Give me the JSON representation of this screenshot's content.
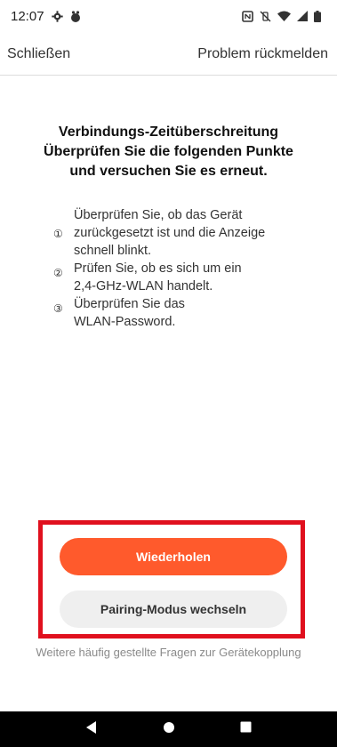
{
  "status_bar": {
    "time": "12:07",
    "icons_left": [
      "settings-icon",
      "notification-icon"
    ],
    "icons_right": [
      "nfc-icon",
      "no-vibrate-icon",
      "wifi-icon",
      "signal-icon",
      "battery-icon"
    ]
  },
  "nav": {
    "close_label": "Schließen",
    "report_label": "Problem rückmelden"
  },
  "title": {
    "line1": "Verbindungs-Zeitüberschreitung",
    "line2": "Überprüfen Sie die folgenden Punkte",
    "line3": "und versuchen Sie es erneut."
  },
  "checks": [
    {
      "num": "①",
      "lines": [
        "Überprüfen Sie, ob das Gerät",
        "zurückgesetzt ist und die Anzeige",
        "schnell blinkt."
      ]
    },
    {
      "num": "②",
      "lines": [
        "Prüfen Sie, ob es sich um ein",
        "2,4-GHz-WLAN handelt."
      ]
    },
    {
      "num": "③",
      "lines": [
        "Überprüfen Sie das",
        "WLAN-Password."
      ]
    }
  ],
  "buttons": {
    "retry_label": "Wiederholen",
    "switch_mode_label": "Pairing-Modus wechseln"
  },
  "faq_label": "Weitere häufig gestellte Fragen zur Gerätekopplung",
  "colors": {
    "primary": "#ff5a2c",
    "secondary_button": "#efefef",
    "highlight_border": "#e0101e"
  },
  "system_nav": [
    "back-icon",
    "home-icon",
    "recents-icon"
  ]
}
